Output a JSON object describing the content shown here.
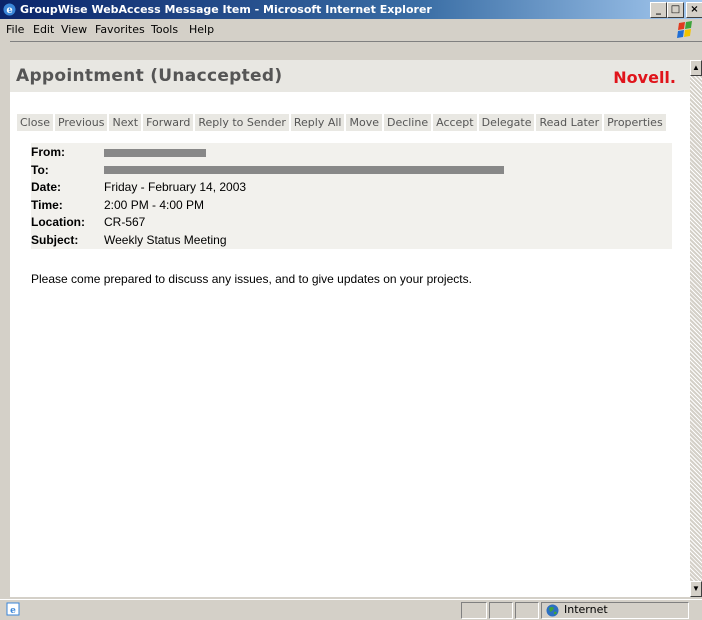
{
  "window": {
    "title": "GroupWise WebAccess Message Item - Microsoft Internet Explorer",
    "controls": [
      "_",
      "□",
      "×"
    ]
  },
  "menu": [
    "File",
    "Edit",
    "View",
    "Favorites",
    "Tools",
    "Help"
  ],
  "page": {
    "title": "Appointment  (Unaccepted)",
    "logo": "Novell."
  },
  "toolbar": [
    "Close",
    "Previous",
    "Next",
    "Forward",
    "Reply to Sender",
    "Reply All",
    "Move",
    "Decline",
    "Accept",
    "Delegate",
    "Read Later",
    "Properties"
  ],
  "fields": [
    {
      "label": "From:",
      "value": ""
    },
    {
      "label": "To:",
      "value": ""
    },
    {
      "label": "Date:",
      "value": "Friday - February 14, 2003"
    },
    {
      "label": "Time:",
      "value": "2:00 PM - 4:00 PM"
    },
    {
      "label": "Location:",
      "value": "CR-567"
    },
    {
      "label": "Subject:",
      "value": "Weekly Status Meeting"
    }
  ],
  "message": "Please come prepared to discuss any issues, and to give updates on your projects.",
  "status": {
    "zone": "Internet"
  },
  "colors": {
    "titlebar": "#0a246a",
    "logo": "#e0141b"
  }
}
